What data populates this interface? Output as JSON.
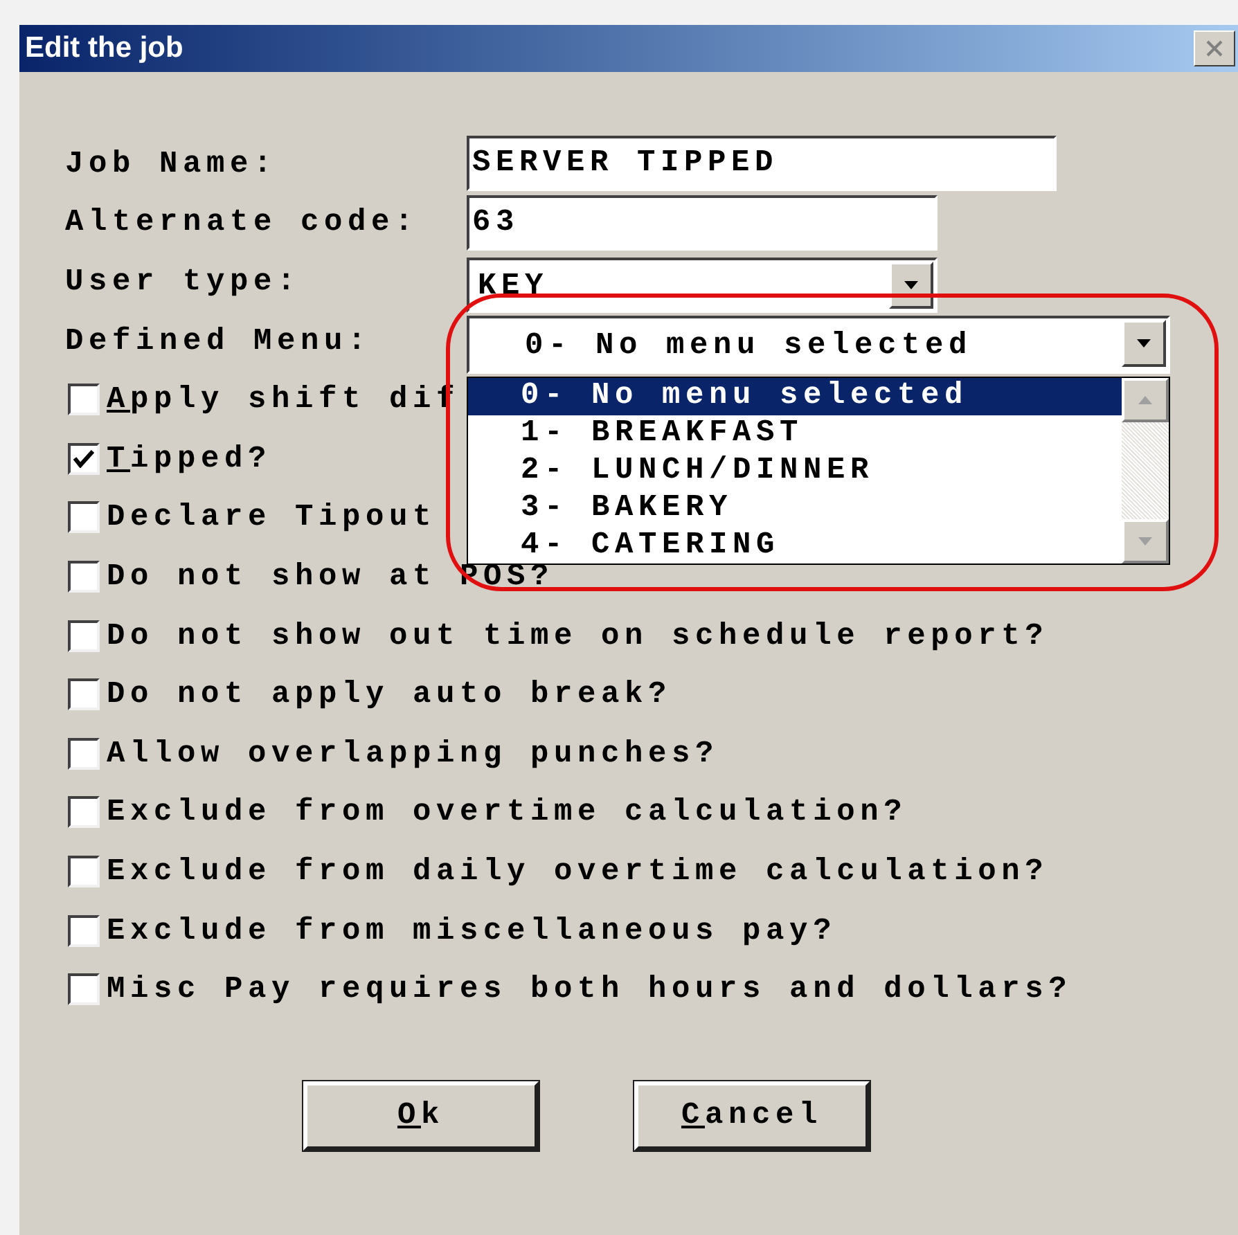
{
  "window": {
    "title": "Edit the job"
  },
  "fields": [
    {
      "kind": "text",
      "label": "Job Name:",
      "value": "SERVER TIPPED"
    },
    {
      "kind": "text",
      "label": "Alternate code:",
      "value": "63"
    },
    {
      "kind": "combo",
      "label": "User type:",
      "value": "KEY"
    },
    {
      "kind": "menu",
      "label": "Defined Menu:",
      "value": "0- No menu selected",
      "expanded": true
    }
  ],
  "menu_options": [
    {
      "label": "0- No menu selected",
      "selected": true
    },
    {
      "label": "1- BREAKFAST",
      "selected": false
    },
    {
      "label": "2- LUNCH/DINNER",
      "selected": false
    },
    {
      "label": "3- BAKERY",
      "selected": false
    },
    {
      "label": "4- CATERING",
      "selected": false
    }
  ],
  "checkboxes": [
    {
      "label": "Apply shift dif",
      "checked": false,
      "first_letter_underlined": true
    },
    {
      "label": "Tipped?",
      "checked": true,
      "first_letter_underlined": true
    },
    {
      "label": "Declare Tipout",
      "checked": false
    },
    {
      "label": "Do not show at POS?",
      "checked": false
    },
    {
      "label": "Do not show out time on schedule report?",
      "checked": false
    },
    {
      "label": "Do not apply auto break?",
      "checked": false
    },
    {
      "label": "Allow overlapping punches?",
      "checked": false
    },
    {
      "label": "Exclude from overtime calculation?",
      "checked": false
    },
    {
      "label": "Exclude from daily overtime calculation?",
      "checked": false
    },
    {
      "label": "Exclude from miscellaneous pay?",
      "checked": false
    },
    {
      "label": "Misc Pay requires both hours and dollars?",
      "checked": false
    }
  ],
  "buttons": [
    {
      "label": "Ok",
      "first_letter_underlined": true
    },
    {
      "label": "Cancel",
      "first_letter_underlined": true
    }
  ]
}
